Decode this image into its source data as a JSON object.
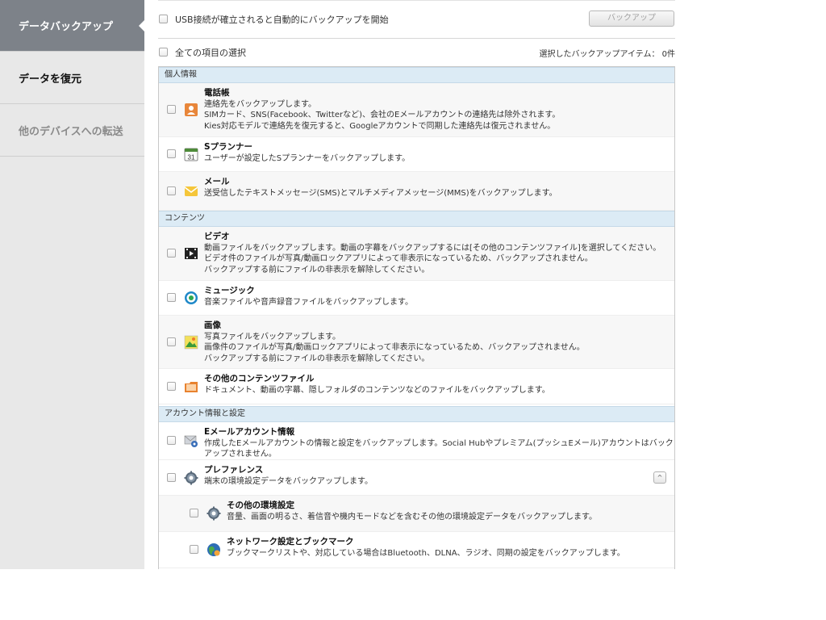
{
  "sidebar": {
    "items": [
      {
        "label": "データバックアップ",
        "state": "active"
      },
      {
        "label": "データを復元",
        "state": "normal"
      },
      {
        "label": "他のデバイスへの転送",
        "state": "disabled"
      }
    ]
  },
  "toolbar": {
    "auto_backup_label": "USB接続が確立されると自動的にバックアップを開始",
    "backup_button": "バックアップ",
    "select_all_label": "全ての項目の選択",
    "selected_count_label": "選択したバックアップアイテム： 0件"
  },
  "sections": [
    {
      "header": "個人情報",
      "items": [
        {
          "title": "電話帳",
          "icon": "contacts-icon",
          "lines": [
            "連絡先をバックアップします。",
            "SIMカード、SNS(Facebook、Twitterなど)、会社のEメールアカウントの連絡先は除外されます。",
            "Kies対応モデルで連絡先を復元すると、Googleアカウントで同期した連絡先は復元されません。"
          ]
        },
        {
          "title": "Sプランナー",
          "icon": "calendar-icon",
          "icon_text": "31",
          "lines": [
            "ユーザーが設定したSプランナーをバックアップします。"
          ]
        },
        {
          "title": "メール",
          "icon": "mail-icon",
          "lines": [
            "送受信したテキストメッセージ(SMS)とマルチメディアメッセージ(MMS)をバックアップします。"
          ]
        }
      ]
    },
    {
      "header": "コンテンツ",
      "items": [
        {
          "title": "ビデオ",
          "icon": "video-icon",
          "lines": [
            "動画ファイルをバックアップします。動画の字幕をバックアップするには[その他のコンテンツファイル]を選択してください。",
            "ビデオ件のファイルが写真/動画ロックアプリによって非表示になっているため、バックアップされません。",
            "バックアップする前にファイルの非表示を解除してください。"
          ]
        },
        {
          "title": "ミュージック",
          "icon": "music-icon",
          "lines": [
            "音楽ファイルや音声録音ファイルをバックアップします。"
          ]
        },
        {
          "title": "画像",
          "icon": "image-icon",
          "lines": [
            "写真ファイルをバックアップします。",
            "画像件のファイルが写真/動画ロックアプリによって非表示になっているため、バックアップされません。",
            "バックアップする前にファイルの非表示を解除してください。"
          ]
        },
        {
          "title": "その他のコンテンツファイル",
          "icon": "folder-icon",
          "lines": [
            "ドキュメント、動画の字幕、隠しフォルダのコンテンツなどのファイルをバックアップします。"
          ]
        }
      ]
    },
    {
      "header": "アカウント情報と設定",
      "items": [
        {
          "title": "Eメールアカウント情報",
          "icon": "email-account-icon",
          "lines": [
            "作成したEメールアカウントの情報と設定をバックアップします。Social Hubやプレミアム(プッシュEメール)アカウントはバックアップされません。"
          ]
        },
        {
          "title": "プレファレンス",
          "icon": "gear-icon",
          "lines": [
            "端末の環境設定データをバックアップします。"
          ],
          "collapse": "^"
        },
        {
          "title": "その他の環境設定",
          "icon": "gear-icon",
          "lines": [
            "音量、画面の明るさ、着信音や機内モードなどを含むその他の環境設定データをバックアップします。"
          ]
        },
        {
          "title": "ネットワーク設定とブックマーク",
          "icon": "globe-icon",
          "lines": [
            "ブックマークリストや、対応している場合はBluetooth、DLNA、ラジオ、同期の設定をバックアップします。"
          ]
        }
      ]
    }
  ]
}
